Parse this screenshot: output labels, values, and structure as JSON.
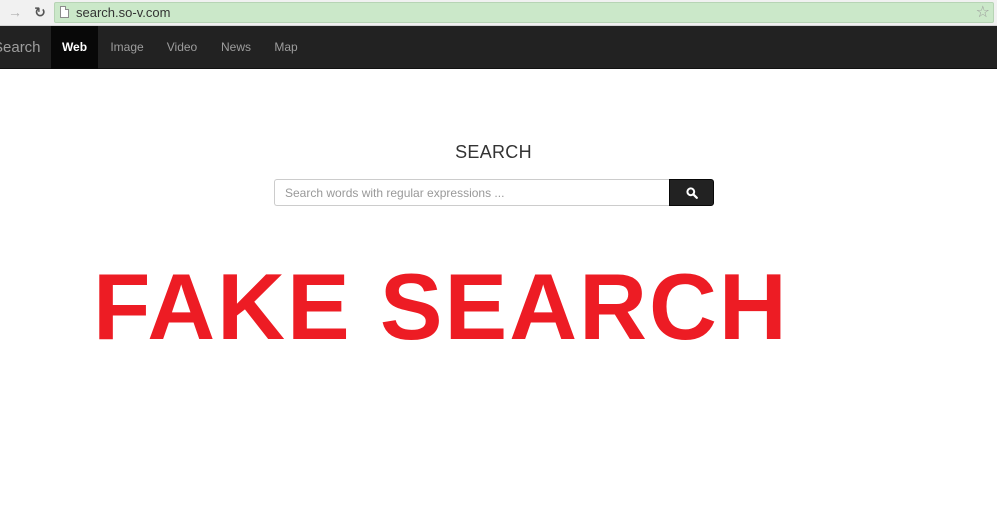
{
  "browser": {
    "url": "search.so-v.com",
    "back_icon": "arrow-right-icon",
    "reload_icon": "reload-icon",
    "star_icon": "star-icon"
  },
  "navbar": {
    "brand": "Search",
    "items": [
      {
        "label": "Web",
        "active": true
      },
      {
        "label": "Image",
        "active": false
      },
      {
        "label": "Video",
        "active": false
      },
      {
        "label": "News",
        "active": false
      },
      {
        "label": "Map",
        "active": false
      }
    ]
  },
  "main": {
    "heading": "SEARCH",
    "search_placeholder": "Search words with regular expressions ...",
    "search_value": "",
    "search_button_icon": "search-icon"
  },
  "overlay": {
    "text": "FAKE SEARCH",
    "color": "#ed1c24"
  },
  "colors": {
    "navbar_bg": "#222222",
    "address_bar_bg": "#cbe8c9",
    "active_tab_bg": "#080808"
  }
}
